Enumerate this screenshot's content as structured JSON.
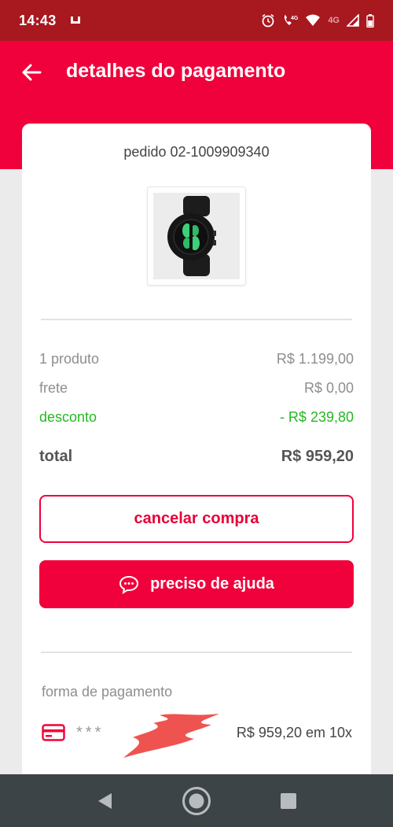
{
  "status_bar": {
    "time": "14:43",
    "network_label": "4G",
    "colors": {
      "background": "#a8181f"
    }
  },
  "header": {
    "title": "detalhes do pagamento",
    "colors": {
      "background": "#f0013b"
    }
  },
  "order": {
    "number_text": "pedido 02-1009909340",
    "product_image": "smartwatch-product-image"
  },
  "summary": {
    "products": {
      "label": "1 produto",
      "value": "R$ 1.199,00"
    },
    "shipping": {
      "label": "frete",
      "value": "R$ 0,00"
    },
    "discount": {
      "label": "desconto",
      "value": "- R$ 239,80"
    },
    "total": {
      "label": "total",
      "value": "R$ 959,20"
    }
  },
  "actions": {
    "cancel_label": "cancelar compra",
    "help_label": "preciso de ajuda",
    "help_icon": "chat-bubble-icon"
  },
  "payment": {
    "section_label": "forma de pagamento",
    "card_icon": "credit-card-icon",
    "card_mask": "***",
    "amount": "R$ 959,20 em 10x"
  },
  "colors": {
    "accent": "#f0013b",
    "discount_green": "#25b822",
    "page_background": "#ebebeb"
  }
}
